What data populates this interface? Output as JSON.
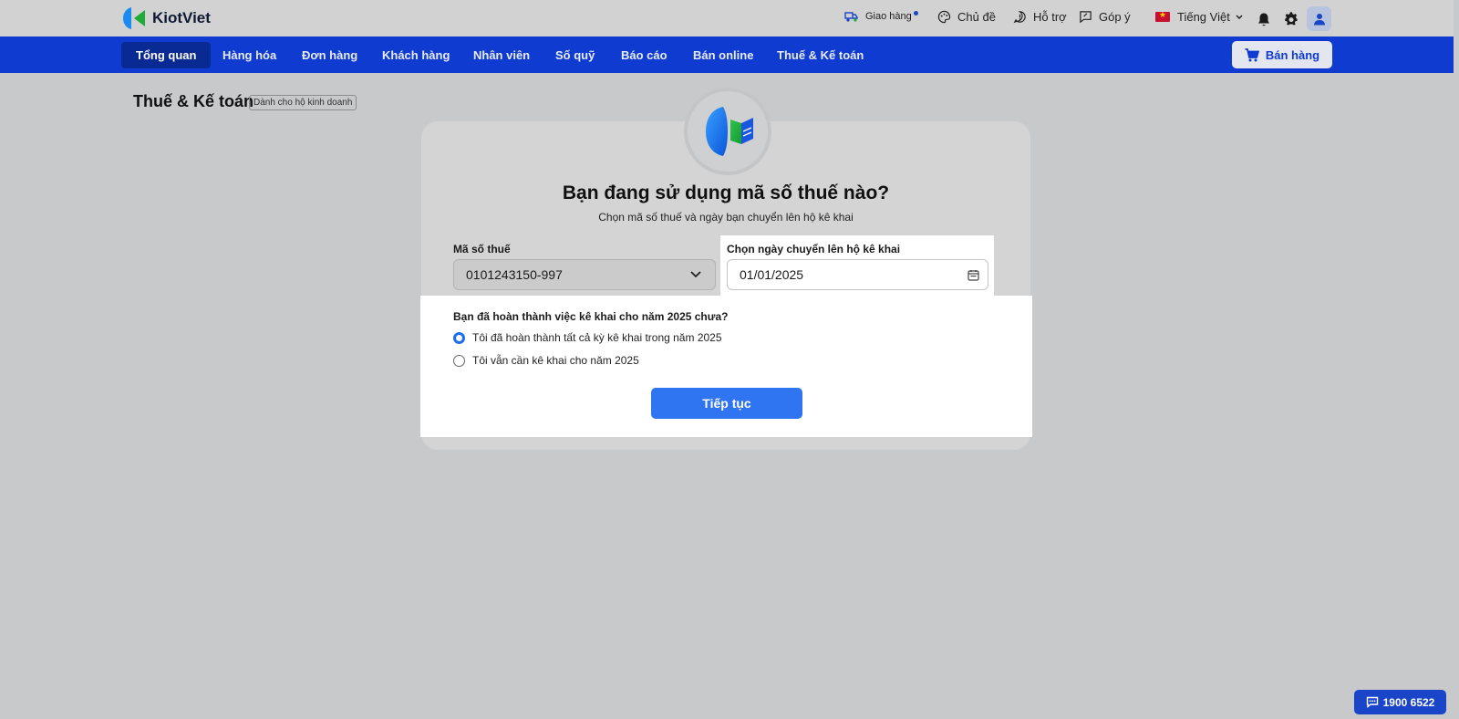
{
  "header": {
    "brand": "KiotViet",
    "delivery_label": "Giao hàng",
    "theme_label": "Chủ đề",
    "support_label": "Hỗ trợ",
    "feedback_label": "Góp ý",
    "language_label": "Tiếng Việt"
  },
  "nav": {
    "items": [
      {
        "label": "Tổng quan"
      },
      {
        "label": "Hàng hóa"
      },
      {
        "label": "Đơn hàng"
      },
      {
        "label": "Khách hàng"
      },
      {
        "label": "Nhân viên"
      },
      {
        "label": "Số quỹ"
      },
      {
        "label": "Báo cáo"
      },
      {
        "label": "Bán online"
      },
      {
        "label": "Thuế & Kế toán"
      }
    ],
    "active": "Tổng quan",
    "sell_label": "Bán hàng"
  },
  "page": {
    "title": "Thuế & Kế toán",
    "badge": "Dành cho hộ kinh doanh"
  },
  "form": {
    "title": "Bạn đang sử dụng mã số thuế nào?",
    "subtitle": "Chọn mã số thuế và ngày bạn chuyển lên hộ kê khai",
    "tax_label": "Mã số thuế",
    "tax_value": "0101243150-997",
    "date_label": "Chọn ngày chuyển lên hộ kê khai",
    "date_value": "01/01/2025",
    "question": "Bạn đã hoàn thành việc kê khai cho năm 2025 chưa?",
    "options": [
      {
        "label": "Tôi đã hoàn thành tất cả kỳ kê khai trong năm 2025",
        "checked": true
      },
      {
        "label": "Tôi vẫn cần kê khai cho năm 2025",
        "checked": false
      }
    ],
    "continue_label": "Tiếp tục"
  },
  "hotline": "1900 6522",
  "colors": {
    "nav_bg": "#0f3bd0",
    "primary_button": "#2f74f0",
    "backdrop": "#c8c9cb"
  }
}
